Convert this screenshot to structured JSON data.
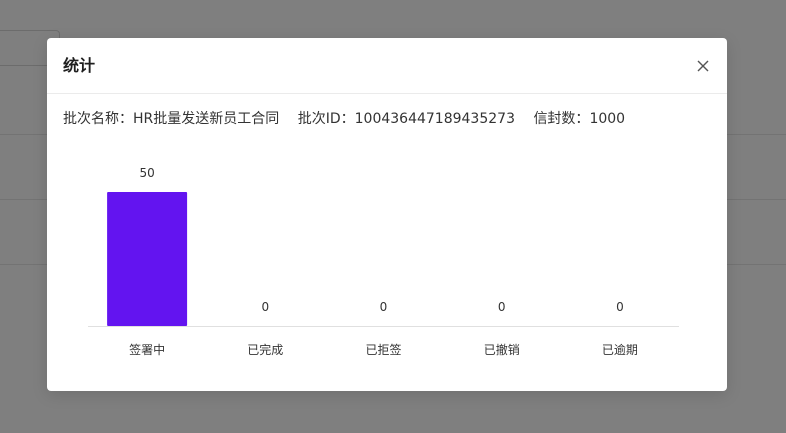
{
  "modal": {
    "title": "统计",
    "batch_name_label": "批次名称：",
    "batch_name_value": "HR批量发送新员工合同",
    "batch_id_label": "批次ID：",
    "batch_id_value": "100436447189435273",
    "envelope_count_label": "信封数：",
    "envelope_count_value": "1000"
  },
  "icons": {
    "close": "close-icon"
  },
  "colors": {
    "bar": "#6314f0",
    "mask": "rgba(0,0,0,0.5)"
  },
  "chart_data": {
    "type": "bar",
    "categories": [
      "签署中",
      "已完成",
      "已拒签",
      "已撤销",
      "已逾期"
    ],
    "values": [
      50,
      0,
      0,
      0,
      0
    ],
    "title": "",
    "xlabel": "",
    "ylabel": "",
    "ylim": [
      0,
      50
    ],
    "grid": false,
    "data_labels": true
  }
}
